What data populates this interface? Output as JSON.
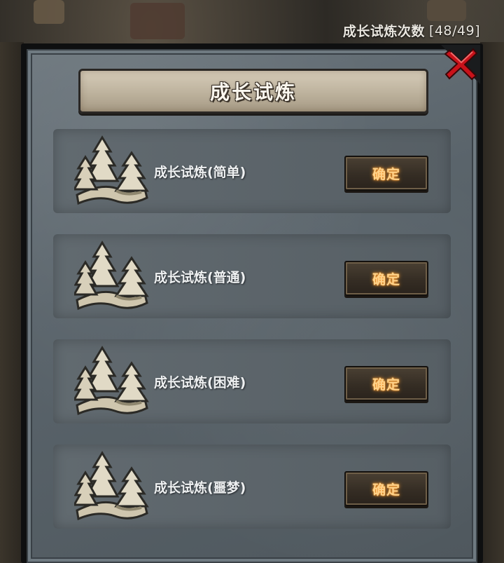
{
  "header": {
    "attempts_label": "成长试炼次数",
    "attempts_value": "[48/49]"
  },
  "dialog": {
    "title": "成长试炼",
    "close_icon": "close-x-icon",
    "trials": [
      {
        "label": "成长试炼(简单)",
        "button": "确定",
        "icon": "forest-icon"
      },
      {
        "label": "成长试炼(普通)",
        "button": "确定",
        "icon": "forest-icon"
      },
      {
        "label": "成长试炼(困难)",
        "button": "确定",
        "icon": "forest-icon"
      },
      {
        "label": "成长试炼(噩梦)",
        "button": "确定",
        "icon": "forest-icon"
      }
    ]
  },
  "colors": {
    "close_red": "#c8121a",
    "button_text": "#ffd28a",
    "panel": "#5a646b"
  }
}
